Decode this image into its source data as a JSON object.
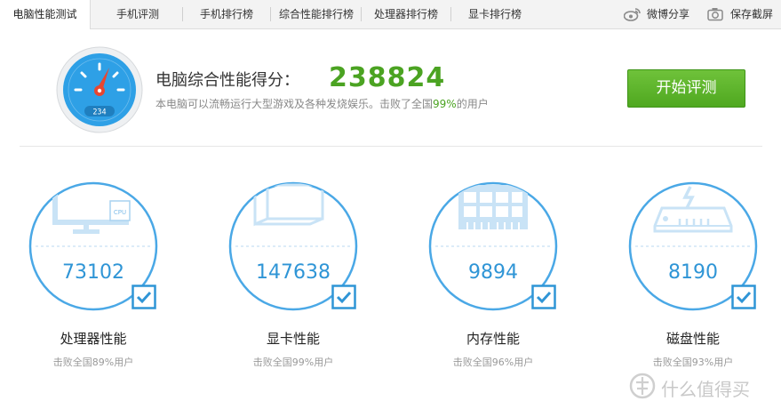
{
  "tabs": [
    {
      "label": "电脑性能测试",
      "active": true
    },
    {
      "label": "手机评测",
      "active": false
    },
    {
      "label": "手机排行榜",
      "active": false
    },
    {
      "label": "综合性能排行榜",
      "active": false
    },
    {
      "label": "处理器排行榜",
      "active": false
    },
    {
      "label": "显卡排行榜",
      "active": false
    }
  ],
  "share": {
    "weibo": "微博分享",
    "screenshot": "保存截屏"
  },
  "gauge": {
    "digits": "234"
  },
  "summary": {
    "title": "电脑综合性能得分：",
    "score": "238824",
    "desc_before": "本电脑可以流畅运行大型游戏及各种发烧娱乐。击败了全国",
    "desc_pct": "99%",
    "desc_after": "的用户"
  },
  "start_button": "开始评测",
  "cards": [
    {
      "id": "cpu",
      "value": "73102",
      "label": "处理器性能",
      "sub": "击败全国89%用户",
      "icon_text": "CPU"
    },
    {
      "id": "gpu",
      "value": "147638",
      "label": "显卡性能",
      "sub": "击败全国99%用户"
    },
    {
      "id": "memory",
      "value": "9894",
      "label": "内存性能",
      "sub": "击败全国96%用户"
    },
    {
      "id": "disk",
      "value": "8190",
      "label": "磁盘性能",
      "sub": "击败全国93%用户"
    }
  ],
  "watermark": "什么值得买",
  "colors": {
    "accent_blue": "#2f95d6",
    "ring_blue": "#4aa8e6",
    "score_green": "#4ba322",
    "button_green": "#5cb52a"
  }
}
